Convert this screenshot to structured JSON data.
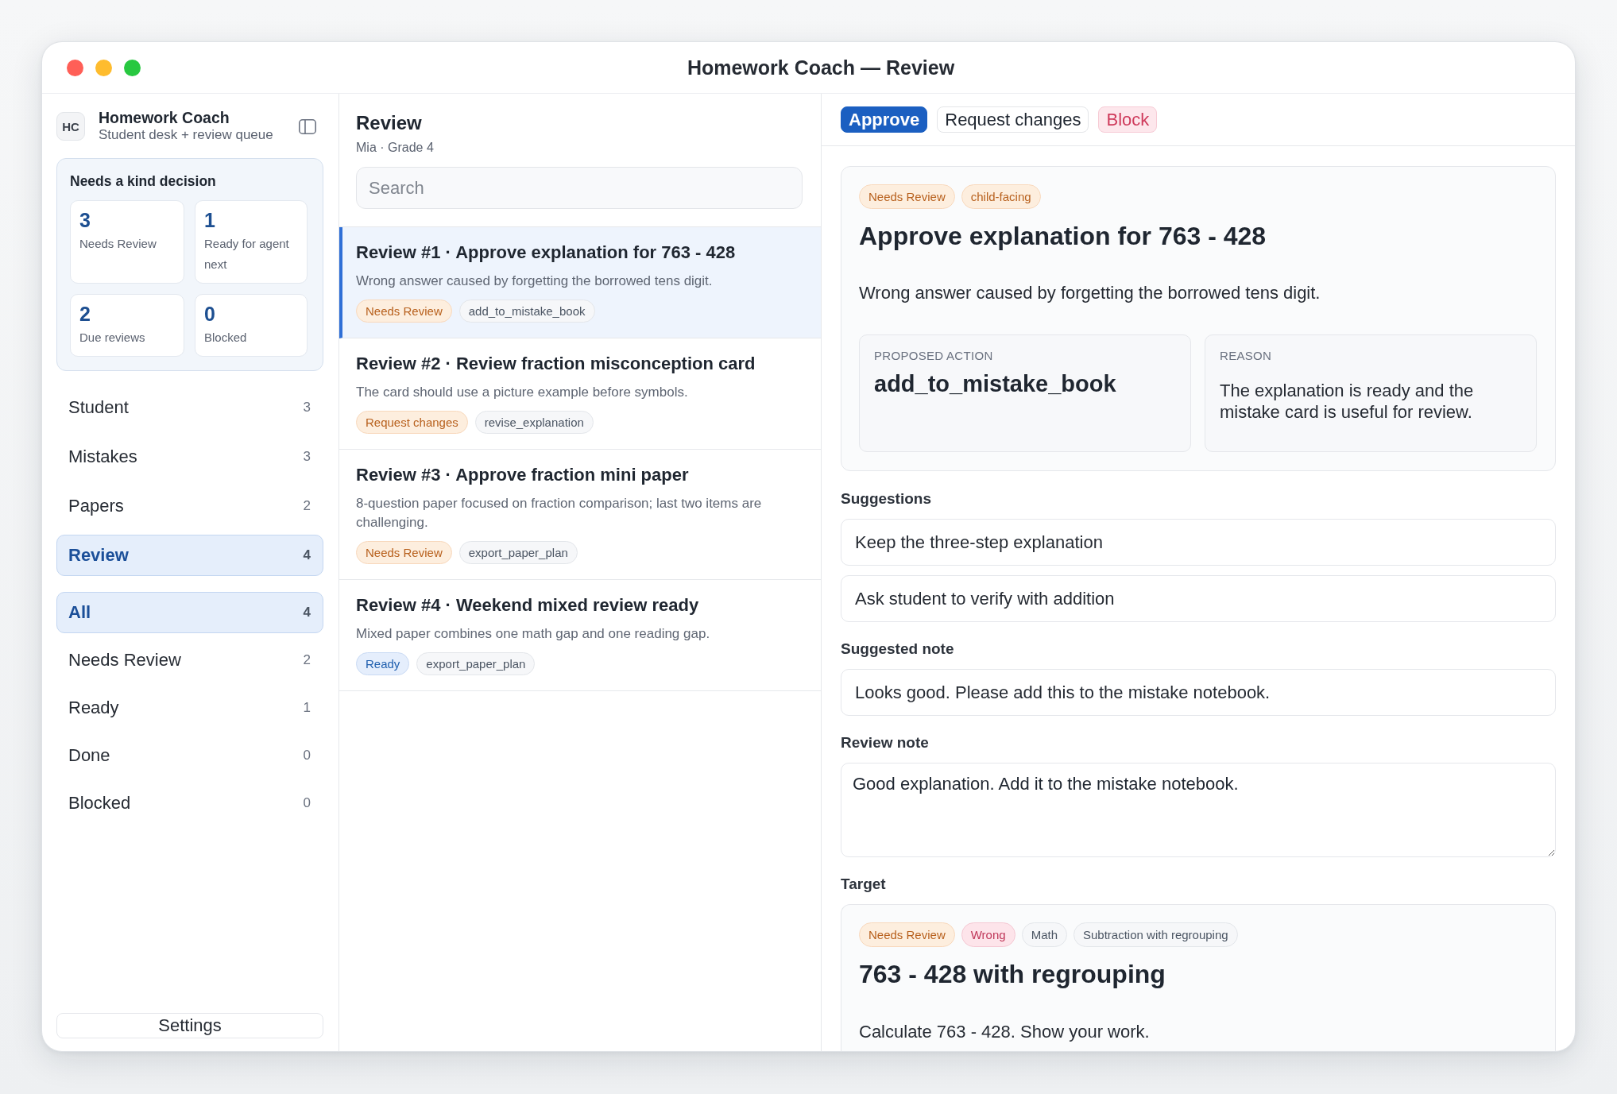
{
  "window": {
    "title": "Homework Coach — Review"
  },
  "sidebar": {
    "brand": {
      "badge": "HC",
      "name": "Homework Coach",
      "subtitle": "Student desk + review queue"
    },
    "decision_card": {
      "title": "Needs a kind decision",
      "stats": [
        {
          "value": "3",
          "label": "Needs Review"
        },
        {
          "value": "1",
          "label": "Ready for agent next"
        },
        {
          "value": "2",
          "label": "Due reviews"
        },
        {
          "value": "0",
          "label": "Blocked"
        }
      ]
    },
    "nav_items": [
      {
        "label": "Student",
        "count": "3",
        "selected": false
      },
      {
        "label": "Mistakes",
        "count": "3",
        "selected": false
      },
      {
        "label": "Papers",
        "count": "2",
        "selected": false
      },
      {
        "label": "Review",
        "count": "4",
        "selected": true
      }
    ],
    "filters": [
      {
        "label": "All",
        "count": "4",
        "selected": true
      },
      {
        "label": "Needs Review",
        "count": "2",
        "selected": false
      },
      {
        "label": "Ready",
        "count": "1",
        "selected": false
      },
      {
        "label": "Done",
        "count": "0",
        "selected": false
      },
      {
        "label": "Blocked",
        "count": "0",
        "selected": false
      }
    ],
    "settings_button": "Settings"
  },
  "review_list": {
    "title": "Review",
    "subtitle": "Mia · Grade 4",
    "search": {
      "placeholder": "Search"
    },
    "items": [
      {
        "title": "Review #1 · Approve explanation for 763 - 428",
        "description": "Wrong answer caused by forgetting the borrowed tens digit.",
        "selected": true,
        "tags": [
          {
            "label": "Needs Review",
            "kind": "warning"
          },
          {
            "label": "add_to_mistake_book",
            "kind": "neutral"
          }
        ]
      },
      {
        "title": "Review #2 · Review fraction misconception card",
        "description": "The card should use a picture example before symbols.",
        "selected": false,
        "tags": [
          {
            "label": "Request changes",
            "kind": "warning"
          },
          {
            "label": "revise_explanation",
            "kind": "neutral"
          }
        ]
      },
      {
        "title": "Review #3 · Approve fraction mini paper",
        "description": "8-question paper focused on fraction comparison; last two items are challenging.",
        "selected": false,
        "tags": [
          {
            "label": "Needs Review",
            "kind": "warning"
          },
          {
            "label": "export_paper_plan",
            "kind": "neutral"
          }
        ]
      },
      {
        "title": "Review #4 · Weekend mixed review ready",
        "description": "Mixed paper combines one math gap and one reading gap.",
        "selected": false,
        "tags": [
          {
            "label": "Ready",
            "kind": "info"
          },
          {
            "label": "export_paper_plan",
            "kind": "neutral"
          }
        ]
      }
    ]
  },
  "detail": {
    "actions": [
      {
        "label": "Approve",
        "kind": "primary"
      },
      {
        "label": "Request changes",
        "kind": "default"
      },
      {
        "label": "Block",
        "kind": "danger"
      }
    ],
    "summary": {
      "tags": [
        {
          "label": "Needs Review",
          "kind": "warning"
        },
        {
          "label": "child-facing",
          "kind": "warning"
        }
      ],
      "title": "Approve explanation for 763 - 428",
      "description": "Wrong answer caused by forgetting the borrowed tens digit.",
      "fields": [
        {
          "label": "PROPOSED ACTION",
          "value": "add_to_mistake_book",
          "kind": "code"
        },
        {
          "label": "REASON",
          "value": "The explanation is ready and the mistake card is useful for review.",
          "kind": "text"
        }
      ]
    },
    "suggestions": {
      "label": "Suggestions",
      "items": [
        "Keep the three-step explanation",
        "Ask student to verify with addition"
      ]
    },
    "suggested_note": {
      "label": "Suggested note",
      "text": "Looks good. Please add this to the mistake notebook."
    },
    "review_note": {
      "label": "Review note",
      "value": "Good explanation. Add it to the mistake notebook."
    },
    "target": {
      "label": "Target",
      "tags": [
        {
          "label": "Needs Review",
          "kind": "warning"
        },
        {
          "label": "Wrong",
          "kind": "danger"
        },
        {
          "label": "Math",
          "kind": "neutral"
        },
        {
          "label": "Subtraction with regrouping",
          "kind": "neutral"
        }
      ],
      "title": "763 - 428 with regrouping",
      "prompt": "Calculate 763 - 428. Show your work."
    }
  }
}
